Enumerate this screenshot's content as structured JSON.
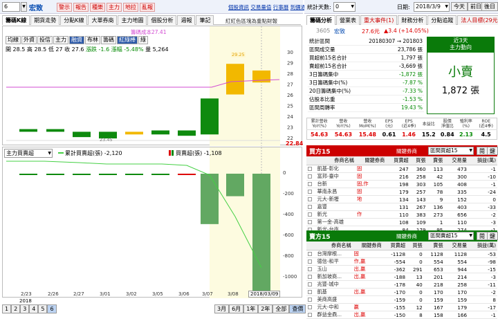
{
  "topbar": {
    "stock_code": "6",
    "stock_name": "宏致",
    "red_buttons": [
      "警示",
      "報告",
      "種樂",
      "主力",
      "地拉",
      "亂報"
    ],
    "links": [
      "個股資訊",
      "交易量值",
      "行事曆",
      "到價通知"
    ],
    "stats_days_label": "統計天數:",
    "stats_days_value": "0",
    "date_label": "日期:",
    "date_value": "2018/3/9",
    "today_btn": "今天",
    "prev_btn": "前日",
    "next_btn": "後日"
  },
  "left_tabs": [
    "籌碼K線",
    "期貨走勢",
    "分點K線",
    "大單券商",
    "主力地圖",
    "個股分析",
    "週報",
    "筆記"
  ],
  "right_tabs": [
    "籌碼分析",
    "營業表",
    "重大事件(1)",
    "財務分析",
    "分點追蹤",
    "法人目標(29元)"
  ],
  "header_note": "紅紅色區塊為重點財報",
  "purple_label": "籌碼成本27.41",
  "controls": [
    "均線",
    "外資",
    "投信",
    "主力",
    "融資",
    "布林",
    "籌碼",
    "紅綠棒",
    "綠"
  ],
  "ohlc": {
    "open_label": "開",
    "open": "28.5",
    "high_label": "高",
    "high": "28.5",
    "low_label": "低",
    "low": "27",
    "close_label": "收",
    "close": "27.6",
    "chg_label": "漲跌",
    "chg": "-1.6",
    "pct_label": "漲幅",
    "pct": "-5.48%",
    "vol_label": "量",
    "vol": "5,264"
  },
  "price_axis": [
    "30",
    "29",
    "28",
    "27",
    "26",
    "25",
    "24",
    "23",
    "22"
  ],
  "last_price": "22.84",
  "high_marker": "29.25",
  "low_marker": "23.45",
  "lower_select": "主力買賣超",
  "lower_legend": {
    "cum_label": "累計買賣超(張)",
    "cum_value": "-2,120",
    "daily_label": "買賣超(張)",
    "daily_value": "-1,108"
  },
  "lower_axis": [
    "0",
    "-200",
    "-400",
    "-600",
    "-800",
    "-1000"
  ],
  "x_labels": [
    "2/23",
    "2/26",
    "2/27",
    "3/01",
    "3/02",
    "3/05",
    "3/06",
    "3/07",
    "3/08"
  ],
  "x_year": "2018",
  "last_date": "2018/03/09",
  "pagination": [
    "1",
    "2",
    "3",
    "4",
    "5",
    "6"
  ],
  "range_buttons": [
    "3月",
    "6月",
    "1年",
    "2年",
    "全部",
    "查價"
  ],
  "summary": {
    "code": "3605",
    "name": "宏致",
    "price": "27.6元",
    "change": "▲3.4 (+14.05%)",
    "rows": [
      [
        "統計區間",
        "20180307 → 201803"
      ],
      [
        "區間成交量",
        "23,786 張"
      ],
      [
        "買超前15名合計",
        "1,797 張"
      ],
      [
        "賣超前15名合計",
        "-3,669 張"
      ],
      [
        "3日籌碼集中",
        "-1,872 張"
      ],
      [
        "3日籌碼集中(%)",
        "-7.87 %"
      ],
      [
        "20日籌碼集中(%)",
        "-7.33 %"
      ],
      [
        "佔股本比重",
        "-1.53 %"
      ],
      [
        "區間周轉率",
        "19.43 %"
      ]
    ],
    "box_title": "近3天",
    "box_sub": "主力動向",
    "box_main": "小賣",
    "box_value": "1,872 張"
  },
  "fin_headers": [
    "累計營收\nYoY(%)",
    "營收\nYoY(%)",
    "營收\nMoM(%)",
    "EPS\n(元)",
    "EPS\n(近4季)",
    "本益比",
    "股價\n淨值比",
    "殖利率\n(%)",
    "ROE\n(近4季)"
  ],
  "fin_values": [
    "54.63",
    "54.63",
    "15.48",
    "0.61",
    "1.46",
    "15.2",
    "0.84",
    "2.13",
    "4.5"
  ],
  "buy15": {
    "title": "買方15",
    "select_label": "關鍵券商",
    "select_value": "區間買超15",
    "b1": "閱",
    "b2": "鍵",
    "cols": [
      "券商名稱",
      "關鍵券商",
      "買賣超",
      "買張",
      "賣張",
      "交易量",
      "損益(萬)"
    ],
    "rows": [
      [
        "凱基-彰化",
        "固",
        "247",
        "360",
        "113",
        "473",
        "-1"
      ],
      [
        "富邦-臺中",
        "固",
        "216",
        "258",
        "42",
        "300",
        "-10"
      ],
      [
        "台新",
        "固,作",
        "198",
        "303",
        "105",
        "408",
        "-1"
      ],
      [
        "華南永昌",
        "固",
        "179",
        "257",
        "78",
        "335",
        "-24"
      ],
      [
        "元大-新壢",
        "地",
        "134",
        "143",
        "9",
        "152",
        "0"
      ],
      [
        "嘉豐",
        "",
        "131",
        "267",
        "136",
        "403",
        "-33"
      ],
      [
        "新光",
        "作",
        "110",
        "383",
        "273",
        "656",
        "-2"
      ],
      [
        "第一金-高雄",
        "",
        "108",
        "109",
        "1",
        "110",
        "-3"
      ],
      [
        "新光-台南",
        "",
        "84",
        "179",
        "95",
        "274",
        "-1"
      ]
    ]
  },
  "sell15": {
    "title": "賣方15",
    "select_label": "關鍵券商",
    "select_value": "區間賣超15",
    "b1": "閱",
    "b2": "鍵",
    "cols": [
      "券商名稱",
      "關鍵券商",
      "買賣超",
      "買張",
      "賣張",
      "交易量",
      "損益(萬)"
    ],
    "rows": [
      [
        "台灣摩根...",
        "固",
        "-1128",
        "0",
        "1128",
        "1128",
        "-53"
      ],
      [
        "德信-和平",
        "作,贏",
        "-554",
        "0",
        "554",
        "554",
        "-98"
      ],
      [
        "玉山",
        "出,贏",
        "-362",
        "291",
        "653",
        "944",
        "-15"
      ],
      [
        "新加坡商...",
        "出,贏",
        "-188",
        "13",
        "201",
        "214",
        "-3"
      ],
      [
        "兆豐-城中",
        "",
        "-178",
        "40",
        "218",
        "258",
        "-11"
      ],
      [
        "凱基",
        "出,贏",
        "-170",
        "0",
        "170",
        "170",
        "-2"
      ],
      [
        "美商高盛",
        "",
        "-159",
        "0",
        "159",
        "159",
        "8"
      ],
      [
        "元大-中和",
        "贏",
        "-155",
        "12",
        "167",
        "179",
        "-17"
      ],
      [
        "群益金鼎...",
        "出,贏",
        "-150",
        "8",
        "158",
        "166",
        "-1"
      ]
    ]
  }
}
